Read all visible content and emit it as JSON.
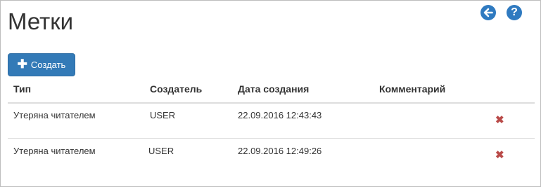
{
  "page": {
    "title": "Метки"
  },
  "toolbar": {
    "back_icon": "arrow-left-circle-icon",
    "help_icon": "question-circle-icon",
    "help_glyph": "?",
    "create_label": "Создать",
    "create_icon": "plus-icon"
  },
  "table": {
    "headers": [
      "Тип",
      "Создатель",
      "Дата создания",
      "Комментарий"
    ],
    "rows": [
      {
        "type": "Утеряна читателем",
        "creator": "USER",
        "date": "22.09.2016 12:43:43",
        "comment": ""
      },
      {
        "type": "Утеряна читателем",
        "creator": "USER",
        "date": "22.09.2016 12:49:26",
        "comment": ""
      }
    ],
    "delete_glyph": "✖",
    "delete_color": "#b94a48"
  },
  "colors": {
    "accent": "#337ab7",
    "icon_bg": "#2f7ac0"
  }
}
